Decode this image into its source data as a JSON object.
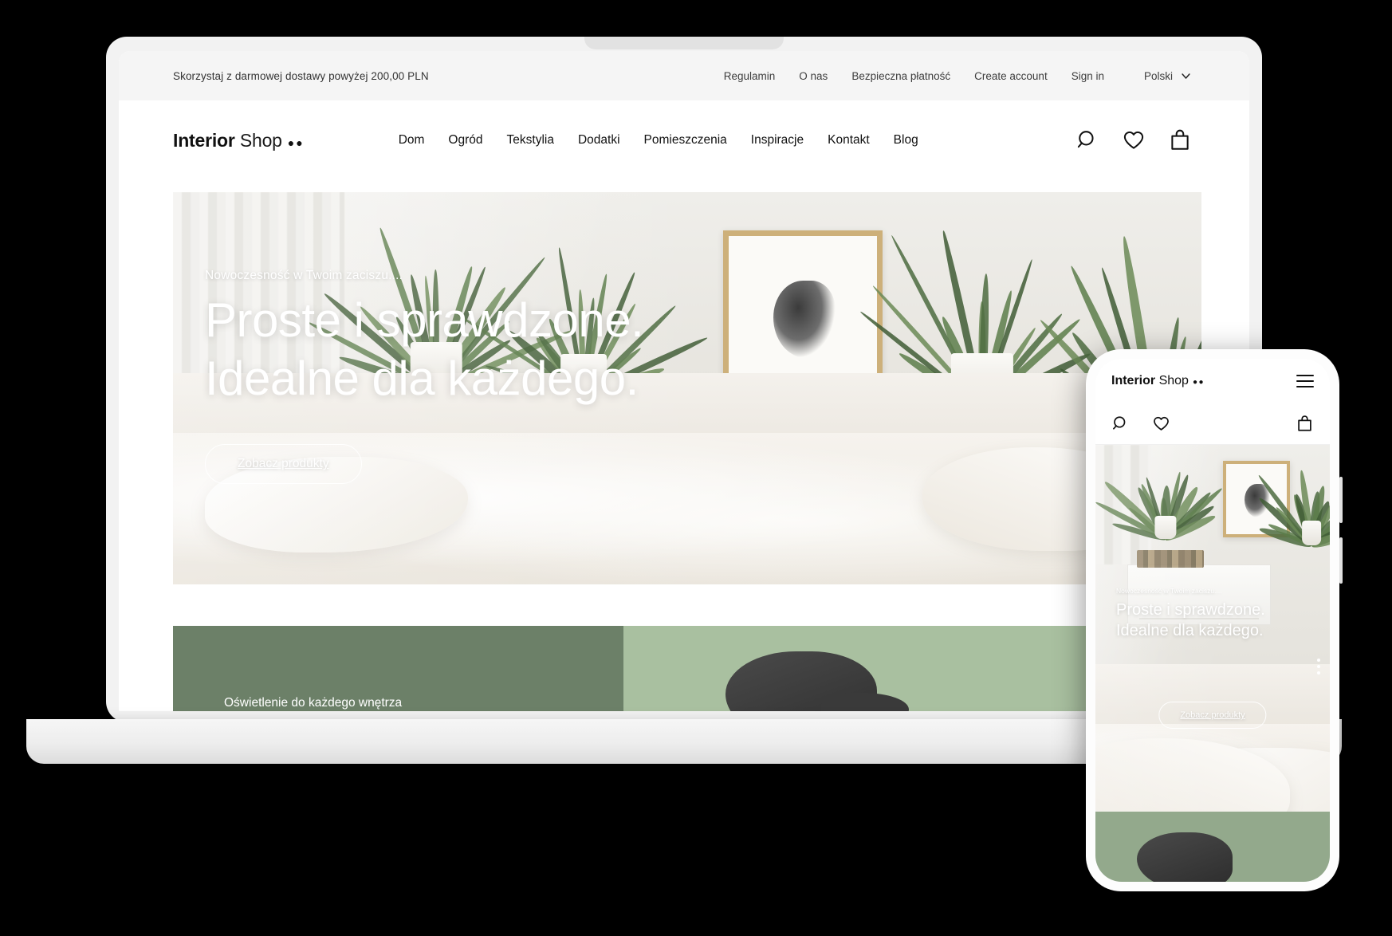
{
  "topbar": {
    "promo": "Skorzystaj z darmowej dostawy powyżej 200,00 PLN",
    "links": [
      {
        "label": "Regulamin"
      },
      {
        "label": "O nas"
      },
      {
        "label": "Bezpieczna płatność"
      },
      {
        "label": "Create account"
      },
      {
        "label": "Sign in"
      }
    ],
    "language": "Polski",
    "chevron_icon": "chevron-down-icon"
  },
  "header": {
    "logo": {
      "bold": "Interior",
      "light": "Shop",
      "dots": "●●"
    },
    "nav": [
      {
        "label": "Dom"
      },
      {
        "label": "Ogród"
      },
      {
        "label": "Tekstylia"
      },
      {
        "label": "Dodatki"
      },
      {
        "label": "Pomieszczenia"
      },
      {
        "label": "Inspiracje"
      },
      {
        "label": "Kontakt"
      },
      {
        "label": "Blog"
      }
    ],
    "icons": [
      {
        "name": "search-icon"
      },
      {
        "name": "heart-icon"
      },
      {
        "name": "shopping-bag-icon"
      }
    ]
  },
  "hero": {
    "eyebrow": "Nowoczesność w Twoim zaciszu....",
    "title_line1": "Proste i sprawdzone.",
    "title_line2": "Idealne dla każdego.",
    "cta_label": "Zobacz produkty"
  },
  "promo_strip": {
    "label": "Oświetlenie do każdego wnętrza",
    "left_color": "#6c8068",
    "right_color": "#a9c0a0"
  },
  "phone": {
    "logo": {
      "bold": "Interior",
      "light": "Shop",
      "dots": "●●"
    },
    "menu_icon": "hamburger-menu-icon",
    "icons": [
      {
        "name": "search-icon"
      },
      {
        "name": "heart-icon"
      },
      {
        "name": "shopping-bag-icon"
      }
    ],
    "hero": {
      "eyebrow": "Nowoczesność w Twoim zaciszu....",
      "title_line1": "Proste i sprawdzone.",
      "title_line2": "Idealne dla każdego.",
      "cta_label": "Zobacz produkty"
    }
  },
  "colors": {
    "topbar_bg": "#f5f5f5",
    "text": "#111111",
    "accent_green_dark": "#6c8068",
    "accent_green_light": "#a9c0a0"
  }
}
